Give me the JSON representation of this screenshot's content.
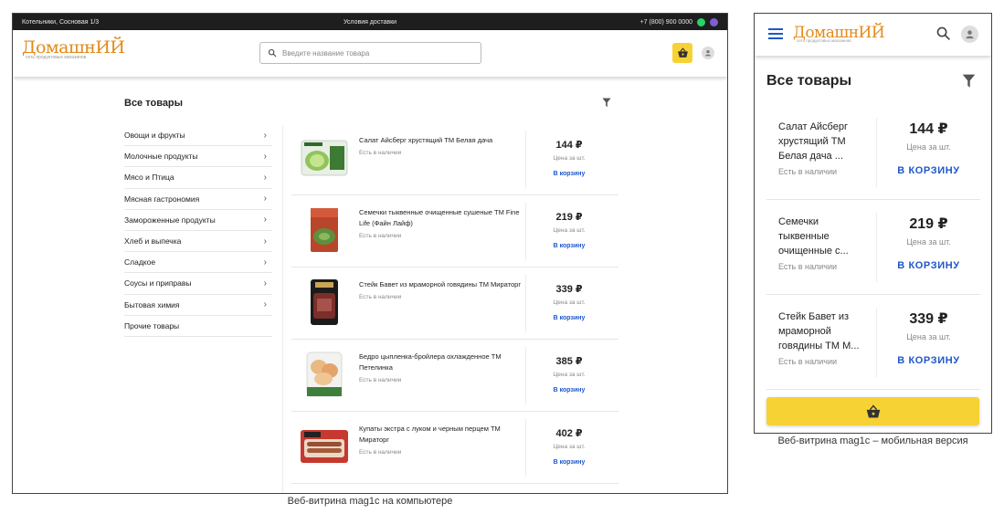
{
  "desktop": {
    "topbar": {
      "address": "Котельники, Сосновая 1/3",
      "delivery": "Условия доставки",
      "phone": "+7 (800) 900 0000"
    },
    "header": {
      "logo_name": "ДомашнИЙ",
      "logo_tagline": "сеть продуктовых магазинов",
      "search_placeholder": "Введите название товара"
    },
    "page_title": "Все товары",
    "categories": [
      {
        "label": "Овощи и фрукты",
        "has_children": true
      },
      {
        "label": "Молочные продукты",
        "has_children": true
      },
      {
        "label": "Мясо и Птица",
        "has_children": true
      },
      {
        "label": "Мясная гастрономия",
        "has_children": true
      },
      {
        "label": "Замороженные продукты",
        "has_children": true
      },
      {
        "label": "Хлеб и выпечка",
        "has_children": true
      },
      {
        "label": "Сладкое",
        "has_children": true
      },
      {
        "label": "Соусы и приправы",
        "has_children": true
      },
      {
        "label": "Бытовая химия",
        "has_children": true
      },
      {
        "label": "Прочие товары",
        "has_children": false
      }
    ],
    "products": [
      {
        "name": "Салат Айсберг хрустящий ТМ Белая дача",
        "stock": "Есть в наличии",
        "price": "144 ₽",
        "per": "Цена за шт.",
        "buy": "В корзину"
      },
      {
        "name": "Семечки тыквенные очищенные сушеные ТМ Fine Life (Файн Лайф)",
        "stock": "Есть в наличии",
        "price": "219 ₽",
        "per": "Цена за шт.",
        "buy": "В корзину"
      },
      {
        "name": "Стейк Бавет из мраморной говядины ТМ Мираторг",
        "stock": "Есть в наличии",
        "price": "339 ₽",
        "per": "Цена за шт.",
        "buy": "В корзину"
      },
      {
        "name": "Бедро цыпленка-бройлера охлажденное ТМ Петелинка",
        "stock": "Есть в наличии",
        "price": "385 ₽",
        "per": "Цена за шт.",
        "buy": "В корзину"
      },
      {
        "name": "Купаты экстра с луком и черным перцем ТМ Мираторг",
        "stock": "Есть в наличии",
        "price": "402 ₽",
        "per": "Цена за шт.",
        "buy": "В корзину"
      }
    ],
    "caption": "Веб-витрина mag1c на компьютере"
  },
  "mobile": {
    "logo_name": "ДомашнИЙ",
    "logo_tagline": "сеть продуктовых магазинов",
    "page_title": "Все товары",
    "products": [
      {
        "name": "Салат Айсберг хрустящий ТМ Белая дача ...",
        "stock": "Есть в наличии",
        "price": "144 ₽",
        "per": "Цена за шт.",
        "buy": "В КОРЗИНУ"
      },
      {
        "name": "Семечки тыквенные очищенные с...",
        "stock": "Есть в наличии",
        "price": "219 ₽",
        "per": "Цена за шт.",
        "buy": "В КОРЗИНУ"
      },
      {
        "name": "Стейк Бавет из мраморной говядины ТМ М...",
        "stock": "Есть в наличии",
        "price": "339 ₽",
        "per": "Цена за шт.",
        "buy": "В КОРЗИНУ"
      }
    ],
    "caption": "Веб-витрина mag1c – мобильная версия"
  },
  "colors": {
    "accent_blue": "#1f57c9",
    "brand_orange": "#e38a1a",
    "cart_yellow": "#f7d235",
    "topbar_dark": "#1e1e1e"
  },
  "icons": {
    "search": "search-icon",
    "cart": "basket-icon",
    "user": "user-icon",
    "filter": "filter-icon",
    "menu": "hamburger-icon",
    "chevron": "chevron-right-icon",
    "whatsapp": "whatsapp-icon",
    "viber": "viber-icon"
  }
}
